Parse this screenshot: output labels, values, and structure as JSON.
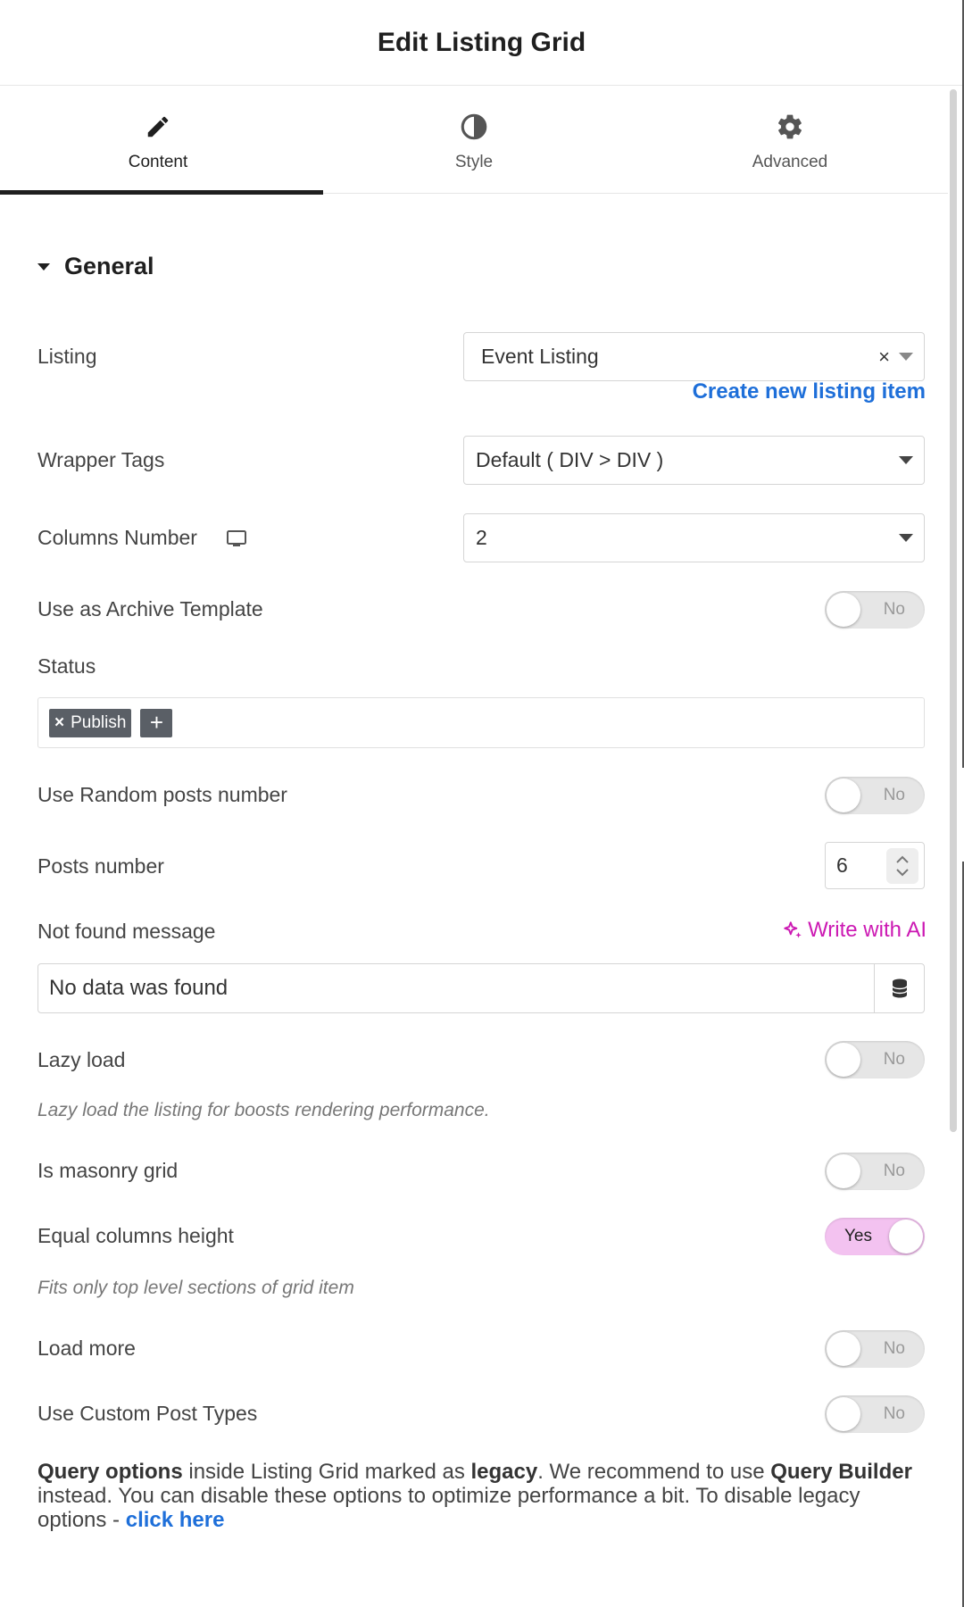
{
  "header": {
    "title": "Edit Listing Grid"
  },
  "tabs": [
    {
      "label": "Content",
      "icon": "pencil-icon",
      "active": true
    },
    {
      "label": "Style",
      "icon": "contrast-icon",
      "active": false
    },
    {
      "label": "Advanced",
      "icon": "gear-icon",
      "active": false
    }
  ],
  "section": {
    "title": "General"
  },
  "listing": {
    "label": "Listing",
    "value": "Event Listing",
    "clear": "×",
    "create_link": "Create new listing item"
  },
  "wrapper_tags": {
    "label": "Wrapper Tags",
    "value": "Default ( DIV > DIV )"
  },
  "columns_number": {
    "label": "Columns Number",
    "value": "2",
    "icon": "desktop-icon"
  },
  "archive_template": {
    "label": "Use as Archive Template",
    "toggle": "No"
  },
  "status": {
    "label": "Status",
    "tag": "Publish",
    "tag_remove": "×",
    "add": "+"
  },
  "random_posts": {
    "label": "Use Random posts number",
    "toggle": "No"
  },
  "posts_number": {
    "label": "Posts number",
    "value": "6"
  },
  "not_found": {
    "label": "Not found message",
    "ai_link": "Write with AI",
    "value": "No data was found"
  },
  "lazy_load": {
    "label": "Lazy load",
    "toggle": "No",
    "description": "Lazy load the listing for boosts rendering performance."
  },
  "masonry": {
    "label": "Is masonry grid",
    "toggle": "No"
  },
  "equal_height": {
    "label": "Equal columns height",
    "toggle": "Yes",
    "description": "Fits only top level sections of grid item"
  },
  "load_more": {
    "label": "Load more",
    "toggle": "No"
  },
  "custom_post_types": {
    "label": "Use Custom Post Types",
    "toggle": "No"
  },
  "notice": {
    "b1": "Query options",
    "t1": " inside Listing Grid marked as ",
    "b2": "legacy",
    "t2": ". We recommend to use ",
    "b3": "Query Builder",
    "t3": " instead. You can disable these options to optimize performance a bit. To disable legacy options - ",
    "link": "click here"
  },
  "colors": {
    "accent_pink": "#cc19b3",
    "link_blue": "#1e6fd9",
    "toggle_on": "#f3c2f0"
  }
}
